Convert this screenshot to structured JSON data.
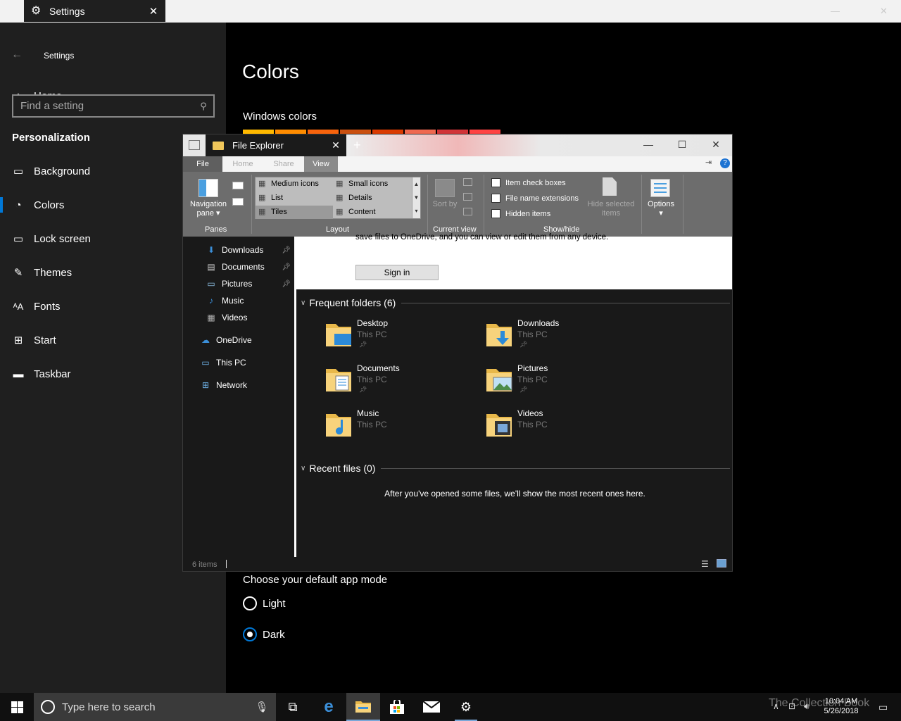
{
  "settings_window": {
    "tab_title": "Settings",
    "app_title": "Settings",
    "search_placeholder": "Find a setting",
    "home_label": "Home",
    "section_title": "Personalization",
    "nav_items": [
      {
        "label": "Background",
        "icon": "image-icon"
      },
      {
        "label": "Colors",
        "icon": "palette-icon"
      },
      {
        "label": "Lock screen",
        "icon": "lock-screen-icon"
      },
      {
        "label": "Themes",
        "icon": "brush-icon"
      },
      {
        "label": "Fonts",
        "icon": "font-icon"
      },
      {
        "label": "Start",
        "icon": "start-icon"
      },
      {
        "label": "Taskbar",
        "icon": "taskbar-icon"
      }
    ],
    "selected_nav": "Colors",
    "page_title": "Colors",
    "windows_colors_label": "Windows colors",
    "swatches": [
      "#ffb900",
      "#ff8c00",
      "#f7630c",
      "#ca5010",
      "#da3b01",
      "#ef6950",
      "#d13438",
      "#ff4343"
    ],
    "app_mode_label": "Choose your default app mode",
    "app_mode_options": [
      {
        "label": "Light",
        "selected": false
      },
      {
        "label": "Dark",
        "selected": true
      }
    ],
    "accent_color": "#0078d7"
  },
  "file_explorer": {
    "tab_title": "File Explorer",
    "ribbon_tabs": [
      "File",
      "Home",
      "Share",
      "View"
    ],
    "active_ribbon_tab": "View",
    "panes": {
      "nav_pane_label": "Navigation pane",
      "group_label": "Panes"
    },
    "layout": {
      "group_label": "Layout",
      "items": [
        "Medium icons",
        "Small icons",
        "List",
        "Details",
        "Tiles",
        "Content"
      ],
      "selected": "Tiles"
    },
    "current_view": {
      "sort_label": "Sort by",
      "group_label": "Current view"
    },
    "show_hide": {
      "group_label": "Show/hide",
      "checkboxes": [
        "Item check boxes",
        "File name extensions",
        "Hidden items"
      ],
      "hide_selected_label": "Hide selected items"
    },
    "options_label": "Options",
    "nav_pane": [
      {
        "label": "Downloads",
        "icon": "download-icon",
        "pinned": true
      },
      {
        "label": "Documents",
        "icon": "document-icon",
        "pinned": true
      },
      {
        "label": "Pictures",
        "icon": "picture-icon",
        "pinned": true
      },
      {
        "label": "Music",
        "icon": "music-icon",
        "pinned": false
      },
      {
        "label": "Videos",
        "icon": "video-icon",
        "pinned": false
      },
      {
        "label": "OneDrive",
        "icon": "cloud-icon",
        "pinned": false
      },
      {
        "label": "This PC",
        "icon": "computer-icon",
        "pinned": false
      },
      {
        "label": "Network",
        "icon": "network-icon",
        "pinned": false
      }
    ],
    "onedrive_text": "save files to OneDrive, and you can view or edit them from any device.",
    "sign_in_label": "Sign in",
    "frequent_header": "Frequent folders (6)",
    "frequent_folders": [
      {
        "name": "Desktop",
        "location": "This PC"
      },
      {
        "name": "Downloads",
        "location": "This PC"
      },
      {
        "name": "Documents",
        "location": "This PC"
      },
      {
        "name": "Pictures",
        "location": "This PC"
      },
      {
        "name": "Music",
        "location": "This PC"
      },
      {
        "name": "Videos",
        "location": "This PC"
      }
    ],
    "recent_header": "Recent files (0)",
    "recent_empty_text": "After you've opened some files, we'll show the most recent ones here.",
    "status_items": "6 items"
  },
  "taskbar": {
    "search_placeholder": "Type here to search",
    "apps": [
      "task-view-icon",
      "edge-icon",
      "file-explorer-icon",
      "store-icon",
      "mail-icon",
      "settings-icon"
    ],
    "clock_time": "10:04 AM",
    "clock_date": "5/26/2018",
    "watermark": "The Collection Book"
  }
}
